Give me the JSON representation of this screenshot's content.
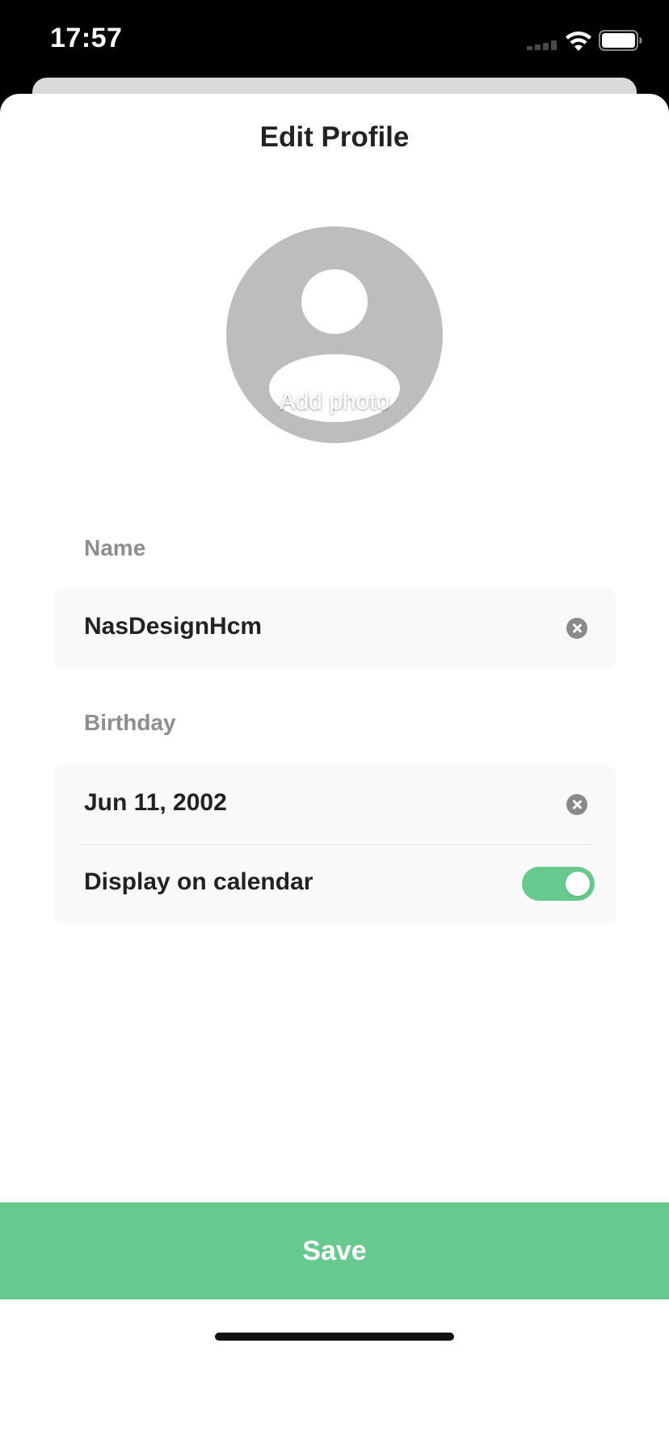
{
  "status_bar": {
    "time": "17:57"
  },
  "sheet": {
    "title": "Edit Profile"
  },
  "avatar": {
    "label": "Add photo"
  },
  "form": {
    "name": {
      "label": "Name",
      "value": "NasDesignHcm"
    },
    "birthday": {
      "label": "Birthday",
      "value": "Jun 11, 2002"
    },
    "display_on_calendar": {
      "label": "Display on calendar",
      "enabled": true
    }
  },
  "actions": {
    "save_label": "Save"
  },
  "colors": {
    "accent": "#67c98d",
    "card_background": "#f9f9f9",
    "label_gray": "#8e8e8e",
    "text_dark": "#222222"
  },
  "icons": {
    "signal": "cellular-signal-icon",
    "wifi": "wifi-icon",
    "battery": "battery-icon",
    "clear": "clear-circle-x-icon",
    "avatar": "person-placeholder-icon"
  }
}
